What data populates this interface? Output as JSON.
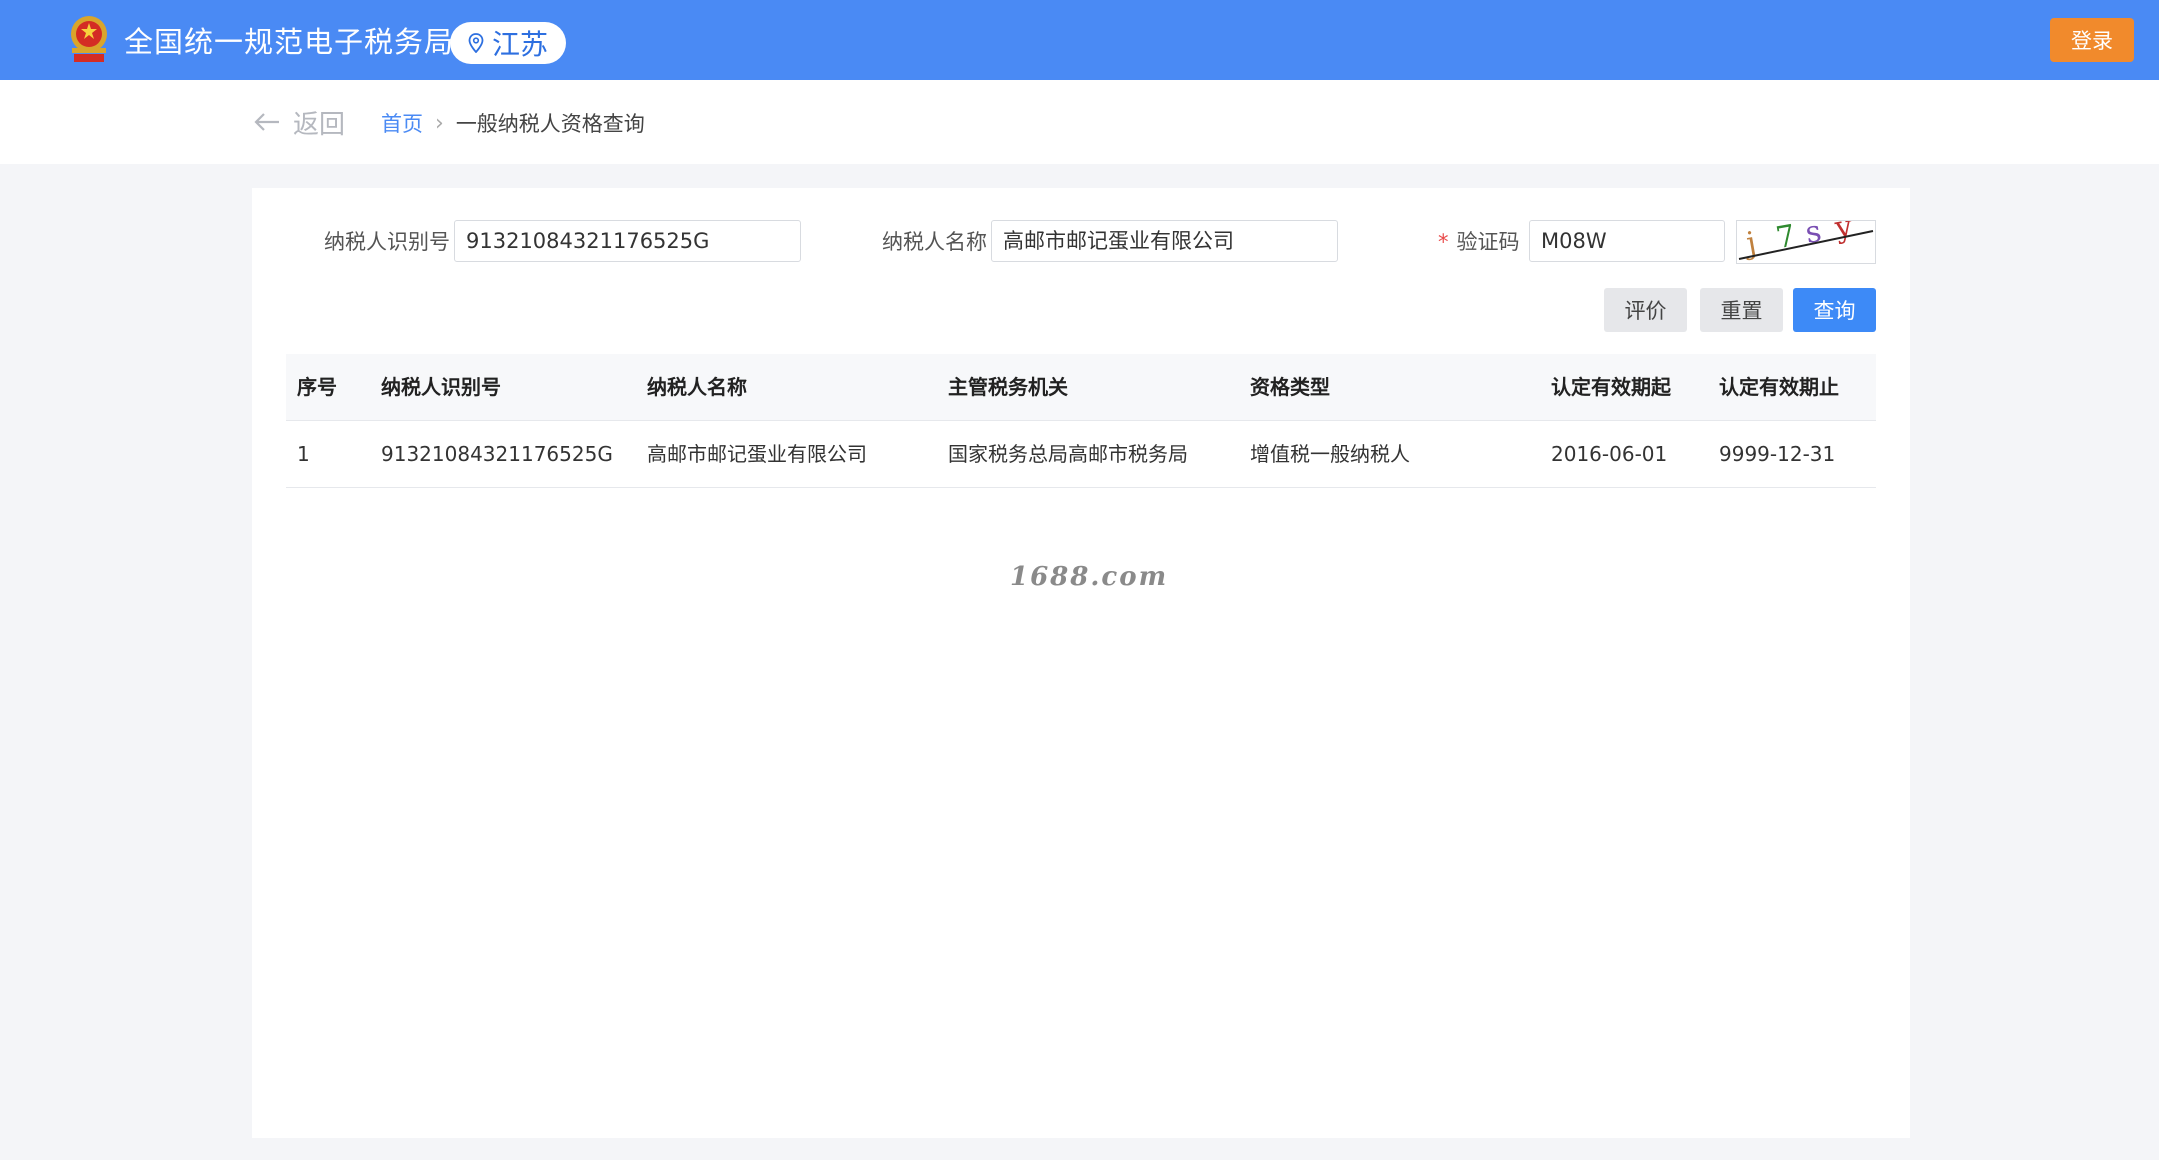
{
  "header": {
    "site_title": "全国统一规范电子税务局",
    "region": "江苏",
    "login_label": "登录"
  },
  "nav": {
    "back_label": "返回",
    "breadcrumb": {
      "home": "首页",
      "separator": "›",
      "current": "一般纳税人资格查询"
    }
  },
  "form": {
    "taxpayer_id": {
      "label": "纳税人识别号",
      "value": "91321084321176525G"
    },
    "taxpayer_name": {
      "label": "纳税人名称",
      "value": "高邮市邮记蛋业有限公司"
    },
    "captcha": {
      "required_mark": "*",
      "label": "验证码",
      "value": "M08W",
      "image_text": "j7sy"
    }
  },
  "actions": {
    "evaluate": "评价",
    "reset": "重置",
    "query": "查询"
  },
  "table": {
    "columns": [
      "序号",
      "纳税人识别号",
      "纳税人名称",
      "主管税务机关",
      "资格类型",
      "认定有效期起",
      "认定有效期止"
    ],
    "rows": [
      [
        "1",
        "91321084321176525G",
        "高邮市邮记蛋业有限公司",
        "国家税务总局高邮市税务局",
        "增值税一般纳税人",
        "2016-06-01",
        "9999-12-31"
      ]
    ]
  },
  "watermark": "1688.com",
  "colors": {
    "header_bg": "#4a8af4",
    "login_bg": "#f18a2c",
    "primary_button": "#3d8af7",
    "required": "#e94b4b"
  }
}
